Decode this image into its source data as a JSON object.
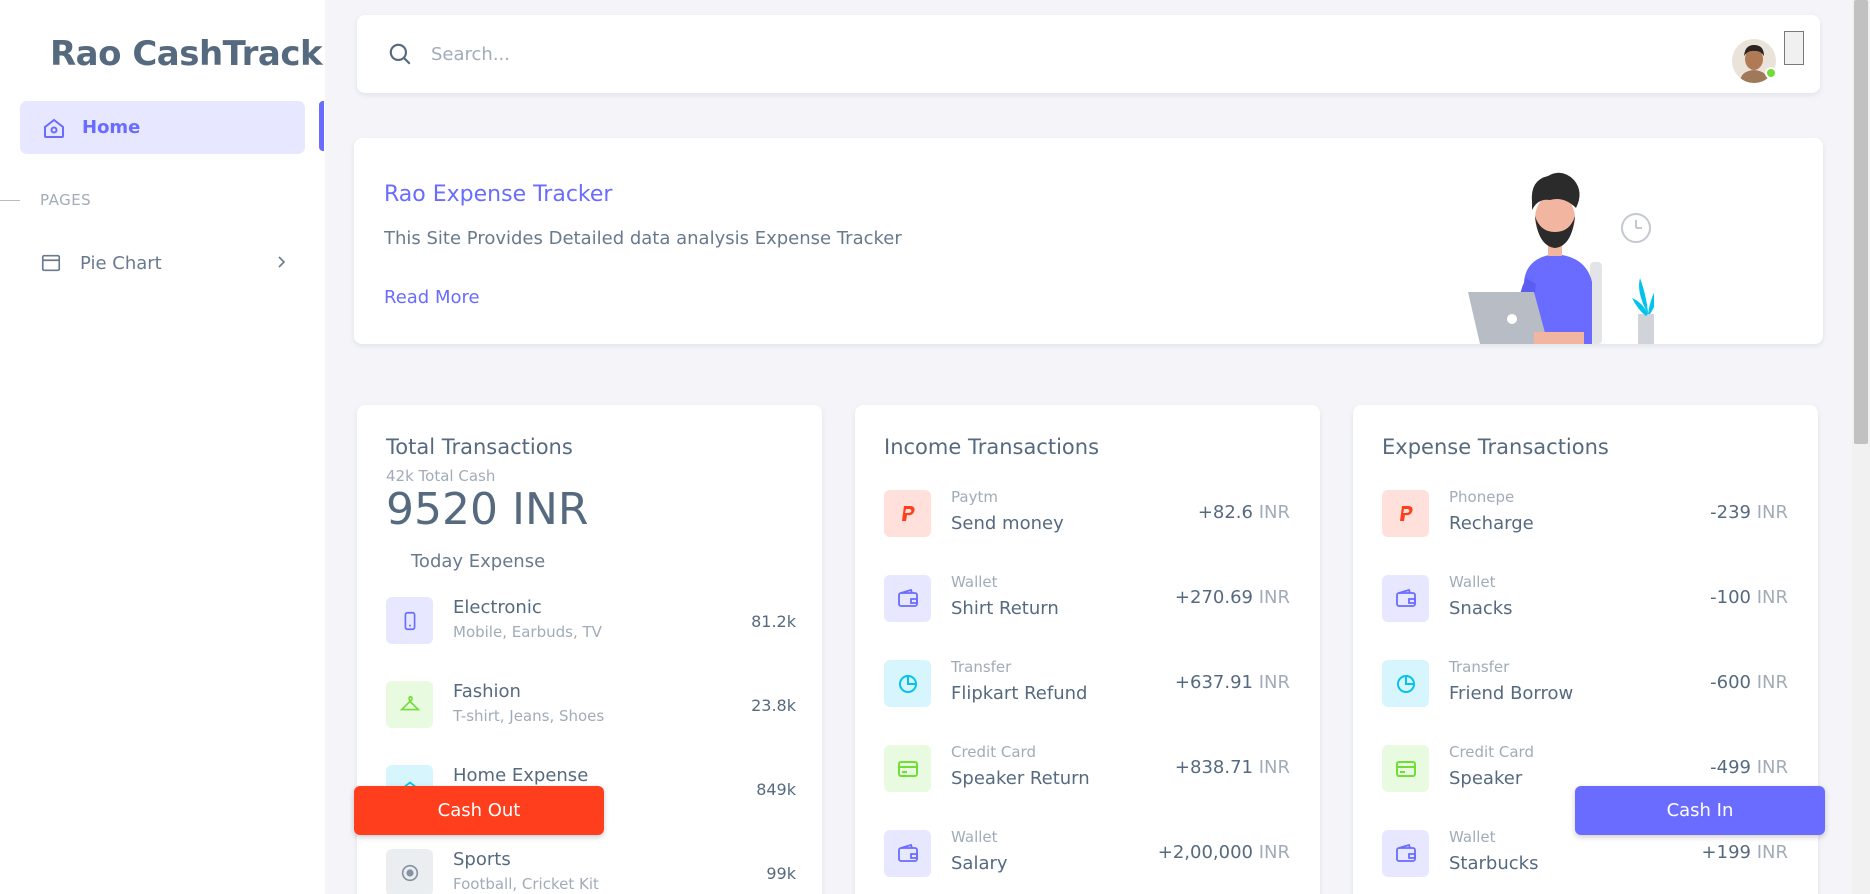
{
  "sidebar": {
    "brand": "Rao CashTrack",
    "home_label": "Home",
    "section_label": "PAGES",
    "pie_chart_label": "Pie Chart"
  },
  "search": {
    "placeholder": "Search..."
  },
  "welcome": {
    "title": "Rao Expense Tracker",
    "description": "This Site Provides Detailed data analysis Expense Tracker",
    "link": "Read More"
  },
  "total": {
    "title": "Total Transactions",
    "subtitle": "42k Total Cash",
    "amount": "9520 INR",
    "today_label": "Today Expense",
    "categories": [
      {
        "name": "Electronic",
        "sub": "Mobile, Earbuds, TV",
        "value": "81.2k",
        "icon": "mobile-icon"
      },
      {
        "name": "Fashion",
        "sub": "T-shirt, Jeans, Shoes",
        "value": "23.8k",
        "icon": "hanger-icon"
      },
      {
        "name": "Home Expense",
        "sub": "",
        "value": "849k",
        "icon": "house-icon"
      },
      {
        "name": "Sports",
        "sub": "Football, Cricket Kit",
        "value": "99k",
        "icon": "football-icon"
      }
    ]
  },
  "income": {
    "title": "Income Transactions",
    "rows": [
      {
        "type": "Paytm",
        "name": "Send money",
        "amount": "+82.6",
        "currency": "INR",
        "icon": "paypal-icon"
      },
      {
        "type": "Wallet",
        "name": "Shirt Return",
        "amount": "+270.69",
        "currency": "INR",
        "icon": "wallet-icon"
      },
      {
        "type": "Transfer",
        "name": "Flipkart Refund",
        "amount": "+637.91",
        "currency": "INR",
        "icon": "chart-icon"
      },
      {
        "type": "Credit Card",
        "name": "Speaker Return",
        "amount": "+838.71",
        "currency": "INR",
        "icon": "credit-card-icon"
      },
      {
        "type": "Wallet",
        "name": "Salary",
        "amount": "+2,00,000",
        "currency": "INR",
        "icon": "wallet-icon"
      }
    ]
  },
  "expense": {
    "title": "Expense Transactions",
    "rows": [
      {
        "type": "Phonepe",
        "name": "Recharge",
        "amount": "-239",
        "currency": "INR",
        "icon": "paypal-icon"
      },
      {
        "type": "Wallet",
        "name": "Snacks",
        "amount": "-100",
        "currency": "INR",
        "icon": "wallet-icon"
      },
      {
        "type": "Transfer",
        "name": "Friend Borrow",
        "amount": "-600",
        "currency": "INR",
        "icon": "chart-icon"
      },
      {
        "type": "Credit Card",
        "name": "Speaker",
        "amount": "-499",
        "currency": "INR",
        "icon": "credit-card-icon"
      },
      {
        "type": "Wallet",
        "name": "Starbucks",
        "amount": "+199",
        "currency": "INR",
        "icon": "wallet-icon"
      }
    ]
  },
  "buttons": {
    "cash_out": "Cash Out",
    "cash_in": "Cash In"
  },
  "colors": {
    "primary": "#696cff",
    "danger": "#ff3e1d",
    "success": "#71dd37",
    "info": "#03c3ec"
  }
}
